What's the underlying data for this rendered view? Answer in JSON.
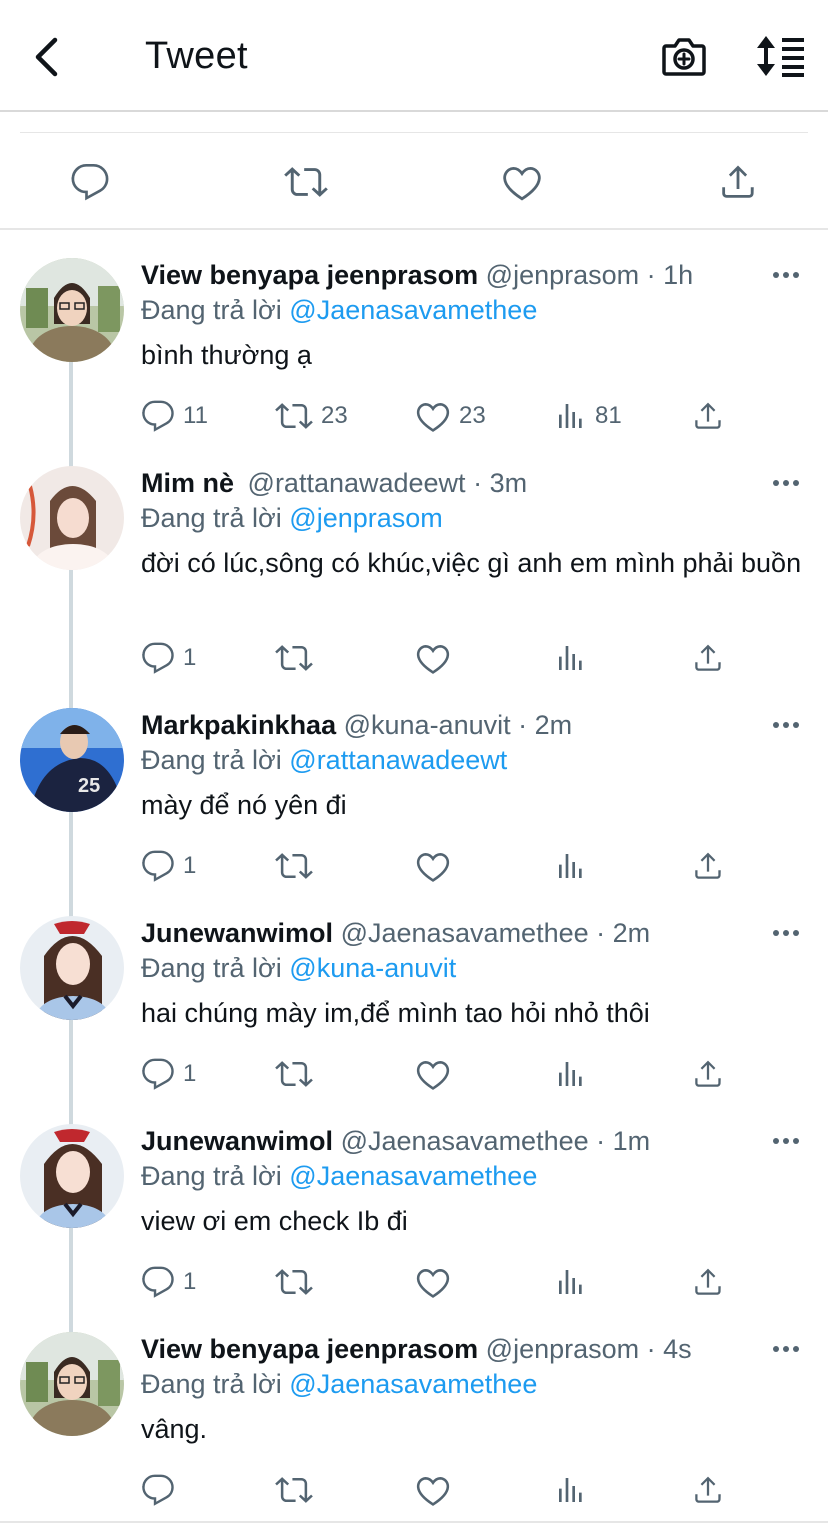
{
  "header": {
    "title": "Tweet"
  },
  "replies": [
    {
      "name": "View benyapa jeenprasom",
      "handle": "@jenprasom",
      "time": "· 1h",
      "replying_prefix": "Đang trả lời",
      "replying_to": "@Jaenasavamethee",
      "text": "bình thường ạ",
      "counts": {
        "reply": "11",
        "retweet": "23",
        "like": "23",
        "views": "81"
      }
    },
    {
      "name": "Mim nè",
      "handle": "@rattanawadeewt",
      "time": "· 3m",
      "replying_prefix": "Đang trả lời",
      "replying_to": "@jenprasom",
      "text": "đời có lúc,sông có khúc,việc gì anh em mình phải buồn",
      "counts": {
        "reply": "1",
        "retweet": "",
        "like": "",
        "views": ""
      }
    },
    {
      "name": "Markpakinkhaa",
      "handle": "@kuna-anuvit",
      "time": "· 2m",
      "replying_prefix": "Đang trả lời",
      "replying_to": "@rattanawadeewt",
      "text": "mày để nó yên đi",
      "counts": {
        "reply": "1",
        "retweet": "",
        "like": "",
        "views": ""
      }
    },
    {
      "name": "Junewanwimol",
      "handle": "@Jaenasavamethee",
      "time": "· 2m",
      "replying_prefix": "Đang trả lời",
      "replying_to": "@kuna-anuvit",
      "text": "hai chúng mày im,để mình tao hỏi nhỏ thôi",
      "counts": {
        "reply": "1",
        "retweet": "",
        "like": "",
        "views": ""
      }
    },
    {
      "name": "Junewanwimol",
      "handle": "@Jaenasavamethee",
      "time": "· 1m",
      "replying_prefix": "Đang trả lời",
      "replying_to": "@Jaenasavamethee",
      "text": "view ơi em check Ib đi",
      "counts": {
        "reply": "1",
        "retweet": "",
        "like": "",
        "views": ""
      }
    },
    {
      "name": "View benyapa jeenprasom",
      "handle": "@jenprasom",
      "time": "· 4s",
      "replying_prefix": "Đang trả lời",
      "replying_to": "@Jaenasavamethee",
      "text": "vâng.",
      "counts": {
        "reply": "",
        "retweet": "",
        "like": "",
        "views": ""
      }
    }
  ],
  "icons": {
    "back": "chevron-left-icon",
    "camera": "camera-add-icon",
    "sort": "sort-icon",
    "reply": "reply-icon",
    "retweet": "retweet-icon",
    "like": "heart-icon",
    "views": "views-icon",
    "share": "share-icon",
    "more": "more-icon"
  },
  "colors": {
    "accent": "#1d9bf0",
    "muted": "#536471",
    "text": "#0f1419"
  }
}
